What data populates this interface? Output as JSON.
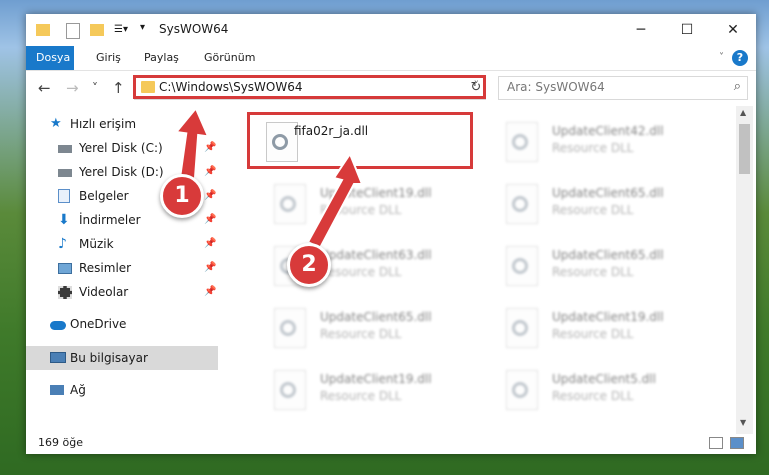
{
  "titlebar": {
    "title": "SysWOW64",
    "minimize": "─",
    "maximize": "☐",
    "close": "✕"
  },
  "ribbon": {
    "tabs": [
      "Dosya",
      "Giriş",
      "Paylaş",
      "Görünüm"
    ],
    "help": "?"
  },
  "nav": {
    "back": "←",
    "forward": "→",
    "recent": "˅",
    "up": "↑",
    "address": "C:\\Windows\\SysWOW64",
    "refresh": "↻",
    "search_placeholder": "Ara: SysWOW64"
  },
  "sidebar": {
    "items": [
      {
        "label": "Hızlı erişim",
        "icon": "star-icon"
      },
      {
        "label": "Yerel Disk (C:)",
        "icon": "drive-icon"
      },
      {
        "label": "Yerel Disk (D:)",
        "icon": "drive-icon"
      },
      {
        "label": "Belgeler",
        "icon": "documents-icon"
      },
      {
        "label": "İndirmeler",
        "icon": "download-icon"
      },
      {
        "label": "Müzik",
        "icon": "music-icon"
      },
      {
        "label": "Resimler",
        "icon": "pictures-icon"
      },
      {
        "label": "Videolar",
        "icon": "video-icon"
      },
      {
        "label": "OneDrive",
        "icon": "cloud-icon"
      },
      {
        "label": "Bu bilgisayar",
        "icon": "computer-icon"
      },
      {
        "label": "Ağ",
        "icon": "network-icon"
      }
    ]
  },
  "files": [
    {
      "name": "fifa02r_ja.dll",
      "type": ""
    },
    {
      "name": "UpdateClient42.dll",
      "type": "Resource DLL"
    },
    {
      "name": "UpdateClient19.dll",
      "type": "Resource DLL"
    },
    {
      "name": "UpdateClient65.dll",
      "type": "Resource DLL"
    },
    {
      "name": "UpdateClient63.dll",
      "type": "Resource DLL"
    },
    {
      "name": "UpdateClient65.dll",
      "type": "Resource DLL"
    },
    {
      "name": "UpdateClient65.dll",
      "type": "Resource DLL"
    },
    {
      "name": "UpdateClient19.dll",
      "type": "Resource DLL"
    },
    {
      "name": "UpdateClient19.dll",
      "type": "Resource DLL"
    },
    {
      "name": "UpdateClient5.dll",
      "type": "Resource DLL"
    }
  ],
  "status": {
    "count": "169 öğe"
  },
  "annotations": {
    "step1": "1",
    "step2": "2",
    "color": "#d83a3a"
  }
}
